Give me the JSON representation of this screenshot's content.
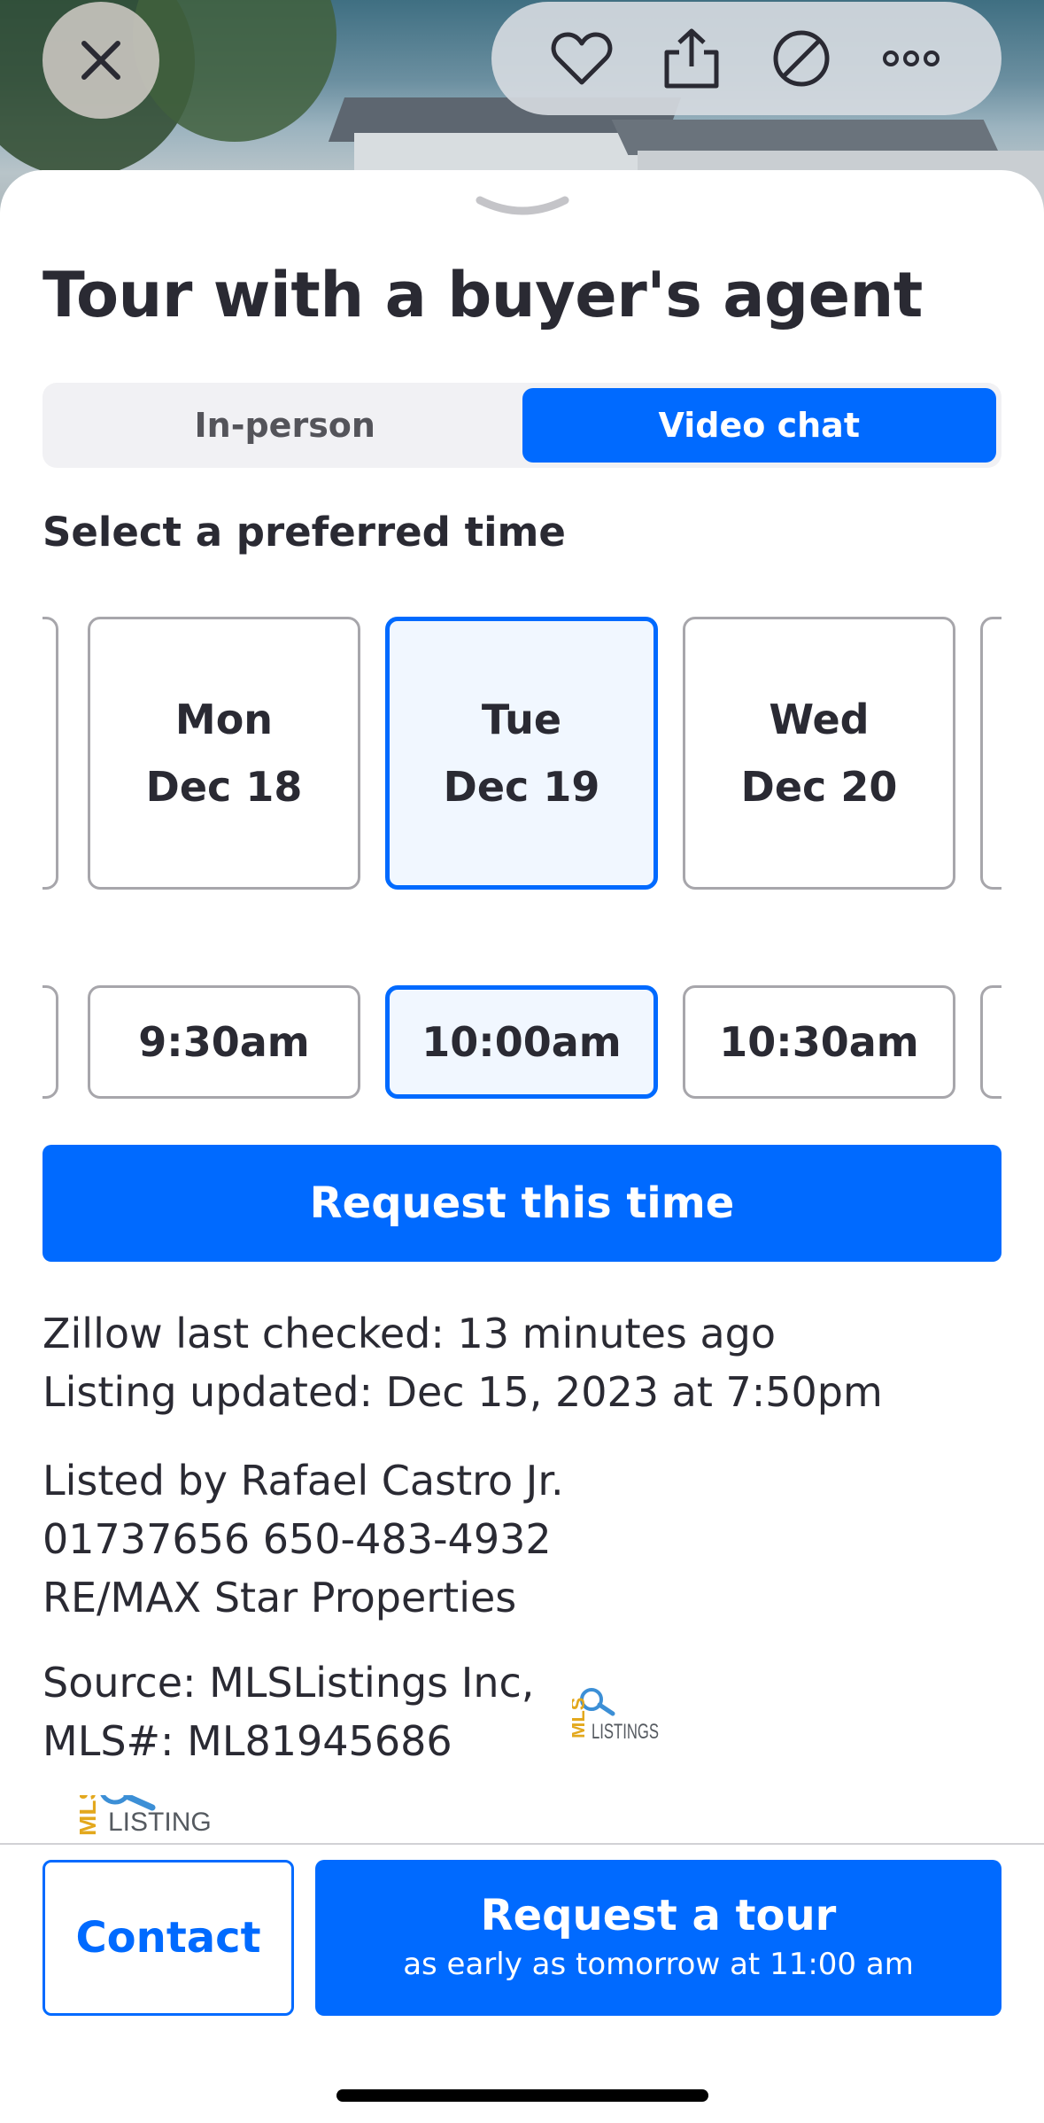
{
  "top_actions": {
    "close_icon": "close-icon",
    "favorite_icon": "heart-icon",
    "share_icon": "share-icon",
    "hide_icon": "hide-icon",
    "more_icon": "more-icon"
  },
  "sheet": {
    "title": "Tour with a buyer's agent",
    "tour_types": [
      {
        "label": "In-person",
        "selected": false
      },
      {
        "label": "Video chat",
        "selected": true
      }
    ],
    "subheading": "Select a preferred time",
    "days": [
      {
        "weekday": "Mon",
        "date": "Dec 18",
        "selected": false
      },
      {
        "weekday": "Tue",
        "date": "Dec 19",
        "selected": true
      },
      {
        "weekday": "Wed",
        "date": "Dec 20",
        "selected": false
      }
    ],
    "times": [
      {
        "label": "9:30am",
        "selected": false
      },
      {
        "label": "10:00am",
        "selected": true
      },
      {
        "label": "10:30am",
        "selected": false
      }
    ],
    "request_time_label": "Request this time",
    "last_checked": "Zillow last checked: 13 minutes ago",
    "listing_updated": "Listing updated: Dec 15, 2023 at 7:50pm",
    "listed_by": "Listed by Rafael Castro Jr.",
    "agent_phone": "01737656 650-483-4932",
    "brokerage": "RE/MAX Star Properties",
    "source": "Source: MLSListings Inc,",
    "mls_number": "MLS#: ML81945686",
    "mls_logo_text": "MLS LISTINGS"
  },
  "footer": {
    "contact_label": "Contact",
    "tour_label": "Request a tour",
    "tour_sub": "as early as tomorrow at 11:00 am"
  },
  "colors": {
    "accent": "#006aff",
    "text": "#2a2a33",
    "selected_bg": "#f1f7ff"
  }
}
